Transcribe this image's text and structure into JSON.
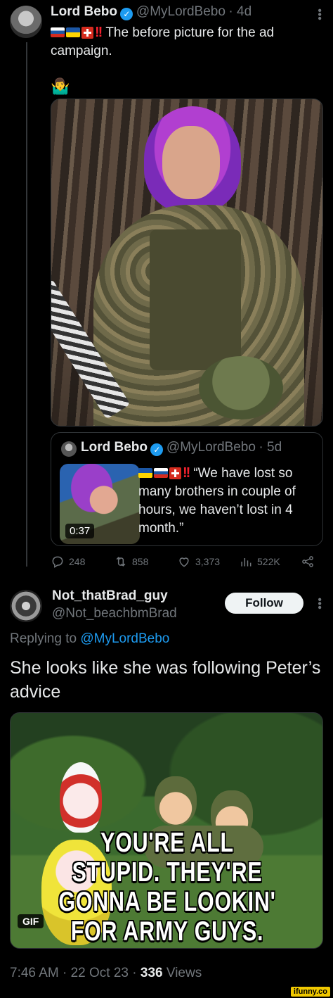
{
  "tweet1": {
    "author_name": "Lord Bebo",
    "handle": "@MyLordBebo",
    "time": "· 4d",
    "text_line1": "The before picture for the ad",
    "text_line2": "campaign.",
    "emoji": "🤷‍♂️",
    "quote": {
      "author_name": "Lord Bebo",
      "handle": "@MyLordBebo",
      "time": "· 5d",
      "text_line1": "“We have lost so",
      "text_line2": "many brothers in couple of",
      "text_line3": "hours, we haven’t lost in 4",
      "text_line4": "month.”",
      "video_duration": "0:37"
    },
    "stats": {
      "replies": "248",
      "retweets": "858",
      "likes": "3,373",
      "views": "522K"
    }
  },
  "tweet2": {
    "author_name": "Not_thatBrad_guy",
    "handle": "@Not_beachbmBrad",
    "follow_label": "Follow",
    "replying_prefix": "Replying to",
    "replying_to": "@MyLordBebo",
    "text_line1": "She looks like she was following Peter’s",
    "text_line2": "advice",
    "gif": {
      "caption_line1": "YOU'RE ALL",
      "caption_line2": "STUPID. THEY'RE",
      "caption_line3": "GONNA BE LOOKIN'",
      "caption_line4": "FOR ARMY GUYS.",
      "badge": "GIF"
    },
    "timestamp": "7:46 AM · 22 Oct 23 ·",
    "views_count": "336",
    "views_label": "Views"
  },
  "watermark": "ifunny.co",
  "colors": {
    "background": "#000000",
    "text": "#e7e9ea",
    "muted": "#71767b",
    "accent": "#1d9bf0",
    "border": "#2f3336"
  }
}
